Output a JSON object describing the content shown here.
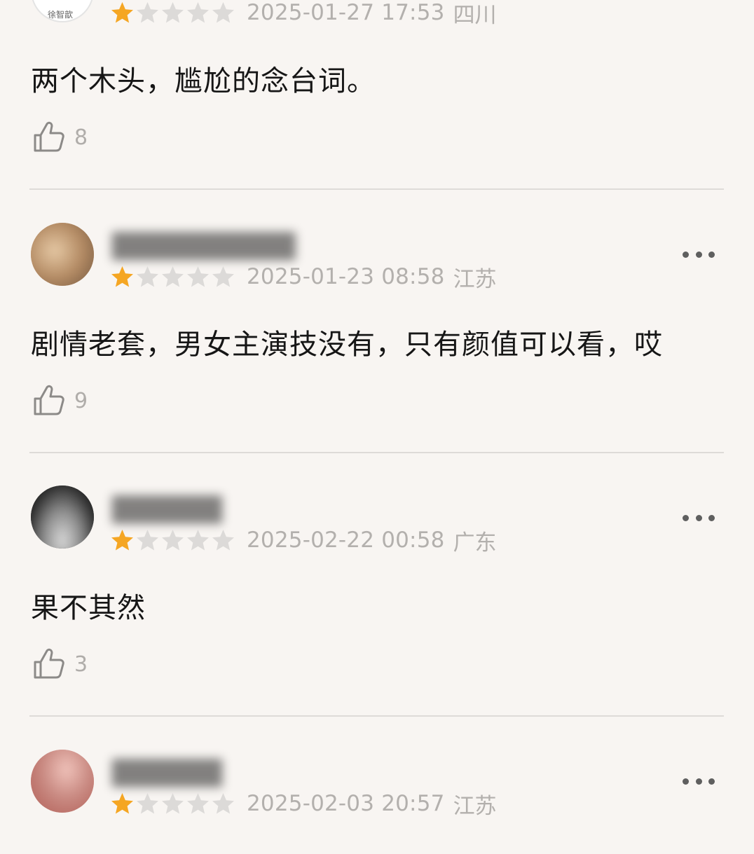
{
  "reviews": [
    {
      "avatar_label": "徐智歆",
      "stars_filled": 1,
      "stars_total": 5,
      "timestamp": "2025-01-27 17:53",
      "location": "四川",
      "comment": "两个木头，尴尬的念台词。",
      "likes": "8"
    },
    {
      "stars_filled": 1,
      "stars_total": 5,
      "timestamp": "2025-01-23 08:58",
      "location": "江苏",
      "comment": "剧情老套，男女主演技没有，只有颜值可以看，哎",
      "likes": "9"
    },
    {
      "stars_filled": 1,
      "stars_total": 5,
      "timestamp": "2025-02-22 00:58",
      "location": "广东",
      "comment": "果不其然",
      "likes": "3"
    },
    {
      "stars_filled": 1,
      "stars_total": 5,
      "timestamp": "2025-02-03 20:57",
      "location": "江苏"
    }
  ],
  "colors": {
    "background": "#f8f5f2",
    "star_filled": "#f5a623",
    "star_empty": "#dcdad8",
    "meta_text": "#b3b0ad",
    "divider": "#dedbd8"
  },
  "icons": {
    "like": "thumbs-up-icon",
    "more": "more-dots-icon",
    "star": "star-icon"
  }
}
